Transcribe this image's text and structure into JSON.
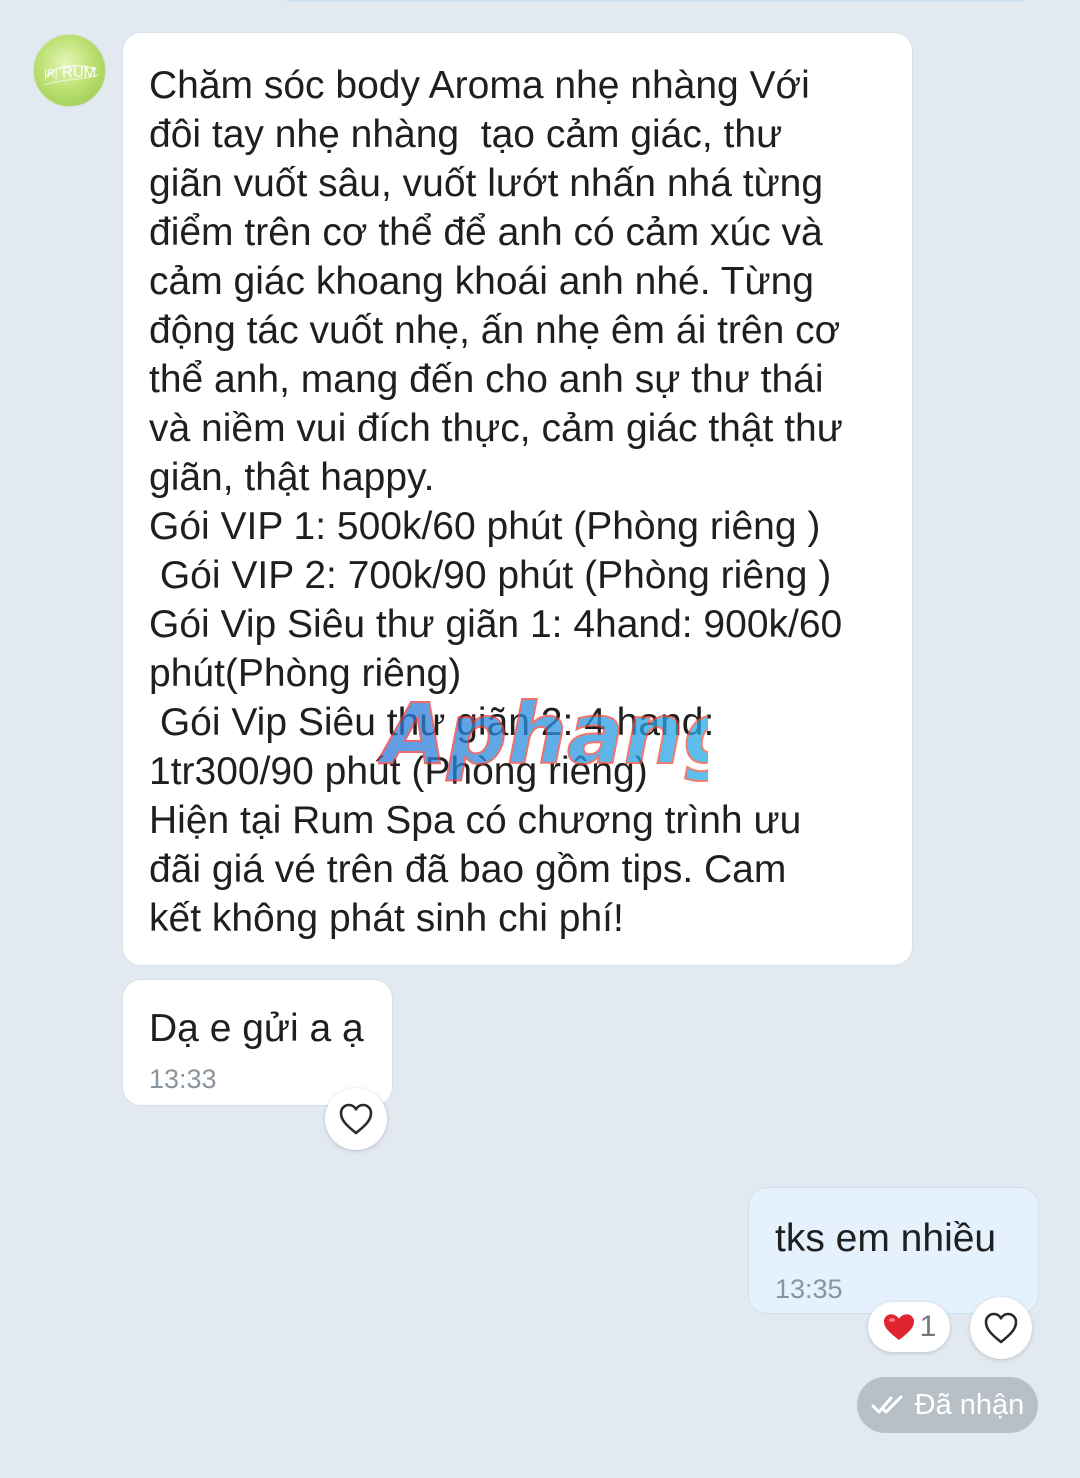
{
  "contact": {
    "avatar_text": "RUM"
  },
  "messages": [
    {
      "direction": "incoming",
      "text": "Chăm sóc body Aroma nhẹ nhàng Với\nđôi tay nhẹ nhàng  tạo cảm giác, thư\ngiãn vuốt sâu, vuốt lướt nhấn nhá từng\nđiểm trên cơ thể để anh có cảm xúc và\ncảm giác khoang khoái anh nhé. Từng\nđộng tác vuốt nhẹ, ấn nhẹ êm ái trên cơ\nthể anh, mang đến cho anh sự thư thái\nvà niềm vui đích thực, cảm giác thật thư\ngiãn, thật happy.\nGói VIP 1: 500k/60 phút (Phòng riêng )\n Gói VIP 2: 700k/90 phút (Phòng riêng )\nGói Vip Siêu thư giãn 1: 4hand: 900k/60\nphút(Phòng riêng)\n Gói Vip Siêu thư giãn 2: 4 hand:\n1tr300/90 phút (Phòng riêng)\nHiện tại Rum Spa có chương trình ưu\nđãi giá vé trên đã bao gồm tips. Cam\nkết không phát sinh chi phí!"
    },
    {
      "direction": "incoming",
      "text": "Dạ e gửi a ạ",
      "time": "13:33"
    },
    {
      "direction": "outgoing",
      "text": "tks em nhiều",
      "time": "13:35",
      "reaction_count": "1"
    }
  ],
  "status": {
    "label": "Đã nhận"
  },
  "watermark": {
    "text": "Aphang"
  },
  "colors": {
    "background": "#e2e9f1",
    "incoming_bubble": "#ffffff",
    "outgoing_bubble": "#e5f2fd",
    "status_chip": "#b8c0c7",
    "reaction_heart": "#e0242f"
  }
}
